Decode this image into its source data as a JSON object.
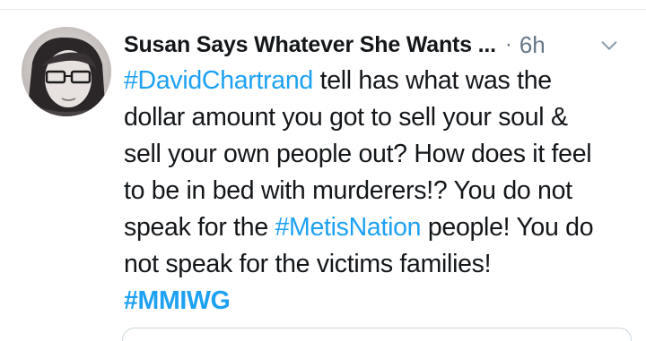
{
  "tweet": {
    "author_name": "Susan Says Whatever She Wants ...",
    "separator": "·",
    "timestamp": "6h",
    "lines": [
      {
        "parts": [
          {
            "hashtag": "#DavidChartrand"
          },
          {
            "text": " tell has what was the"
          }
        ]
      },
      {
        "parts": [
          {
            "text": "dollar amount you got to sell your soul &"
          }
        ]
      },
      {
        "parts": [
          {
            "text": "sell your own people out? How does it feel"
          }
        ]
      },
      {
        "parts": [
          {
            "text": "to be in bed with murderers!? You do not"
          }
        ]
      },
      {
        "parts": [
          {
            "text": "speak for the "
          },
          {
            "hashtag": "#MetisNation"
          },
          {
            "text": " people! You do"
          }
        ]
      },
      {
        "parts": [
          {
            "text": "not speak for the victims families!"
          }
        ]
      },
      {
        "parts": [
          {
            "hashtag_bold": "#MMIWG"
          }
        ]
      }
    ]
  },
  "icons": {
    "menu": "chevron-down-icon",
    "avatar": "avatar-photo"
  },
  "colors": {
    "text": "#14171a",
    "muted": "#657786",
    "link": "#1da1f2",
    "divider": "#e6ecf0"
  }
}
